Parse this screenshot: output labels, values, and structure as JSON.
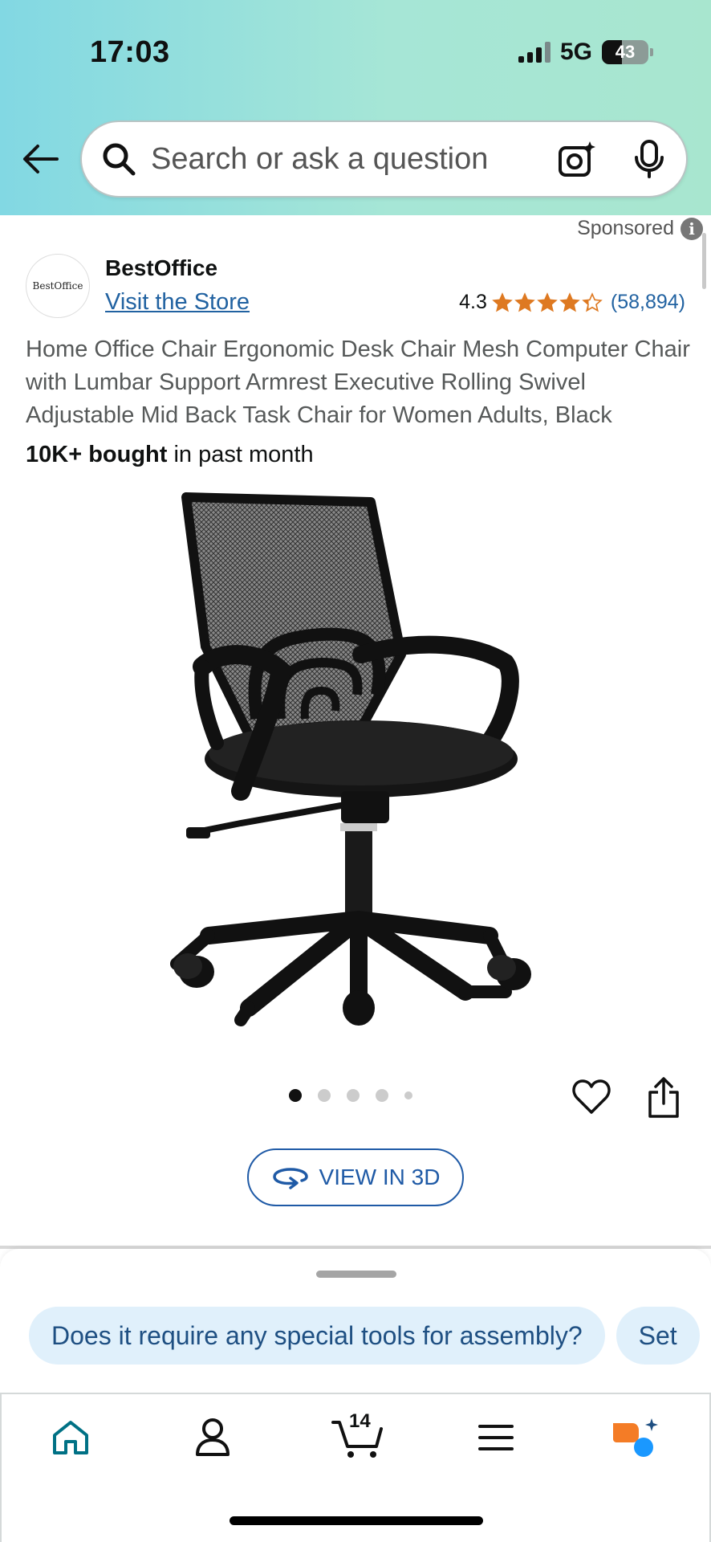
{
  "status_bar": {
    "time": "17:03",
    "network": "5G",
    "battery": "43"
  },
  "search": {
    "placeholder": "Search or ask a question"
  },
  "listing": {
    "sponsored_label": "Sponsored",
    "brand": "BestOffice",
    "brand_logo_text": "BestOffice",
    "visit_store": "Visit the Store",
    "rating": "4.3",
    "rating_value": 4.3,
    "rating_count": "(58,894)",
    "title": "Home Office Chair Ergonomic Desk Chair Mesh Computer Chair with Lumbar Support Armrest Executive Rolling Swivel Adjustable Mid Back Task Chair for Women Adults, Black",
    "bought_strong": "10K+ bought",
    "bought_rest": " in past month",
    "image_count": 5,
    "active_image": 1,
    "view_3d_label": "VIEW IN 3D"
  },
  "sheet": {
    "chips": [
      "Does it require any special tools for assembly?",
      "Set"
    ]
  },
  "nav": {
    "cart_count": "14",
    "items": [
      "home-icon",
      "account-icon",
      "cart-icon",
      "menu-icon",
      "rufus-icon"
    ]
  },
  "colors": {
    "link": "#2162a1",
    "star": "#de7921",
    "home_active": "#007185",
    "chip_bg": "#e0f0fb",
    "rufus_orange": "#f47c26",
    "rufus_blue": "#1a98ff"
  }
}
